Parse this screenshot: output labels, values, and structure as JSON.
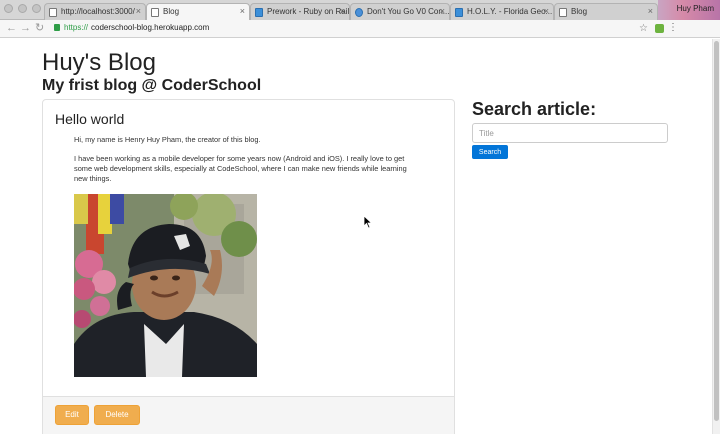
{
  "browser": {
    "tabs": [
      {
        "label": "http://localhost:3000/",
        "active": false
      },
      {
        "label": "Blog",
        "active": true
      },
      {
        "label": "Prework - Ruby on Rails",
        "active": false
      },
      {
        "label": "Don't You Go V0 Con...",
        "active": false
      },
      {
        "label": "H.O.L.Y. - Florida Geo...",
        "active": false
      },
      {
        "label": "Blog",
        "active": false
      }
    ],
    "profile_name": "Huy Pham",
    "url_scheme": "https://",
    "url_host": "coderschool-blog.herokuapp.com",
    "accent_green": "#2e9d47"
  },
  "site": {
    "title": "Huy's Blog",
    "subtitle": "My frist blog @ CoderSchool"
  },
  "post": {
    "title": "Hello world",
    "paragraph_1": "Hi, my name is Henry Huy Pham, the creator of this blog.",
    "paragraph_2": "I have been working as a mobile developer for some years now (Android and iOS). I really love to get some web development skills, especially at CodeSchool, where I can make new friends while learning new things.",
    "image_alt": "photo of the author",
    "edit_label": "Edit",
    "delete_label": "Delete",
    "button_color": "#f0ad4e"
  },
  "search": {
    "heading": "Search article:",
    "placeholder": "Title",
    "button_label": "Search",
    "button_color": "#0275d8"
  },
  "icons": {
    "back": "back-arrow-icon",
    "forward": "forward-arrow-icon",
    "reload": "reload-icon",
    "lock": "lock-icon",
    "star": "star-icon",
    "menu": "menu-dots-icon",
    "cursor": "mouse-pointer-icon"
  }
}
